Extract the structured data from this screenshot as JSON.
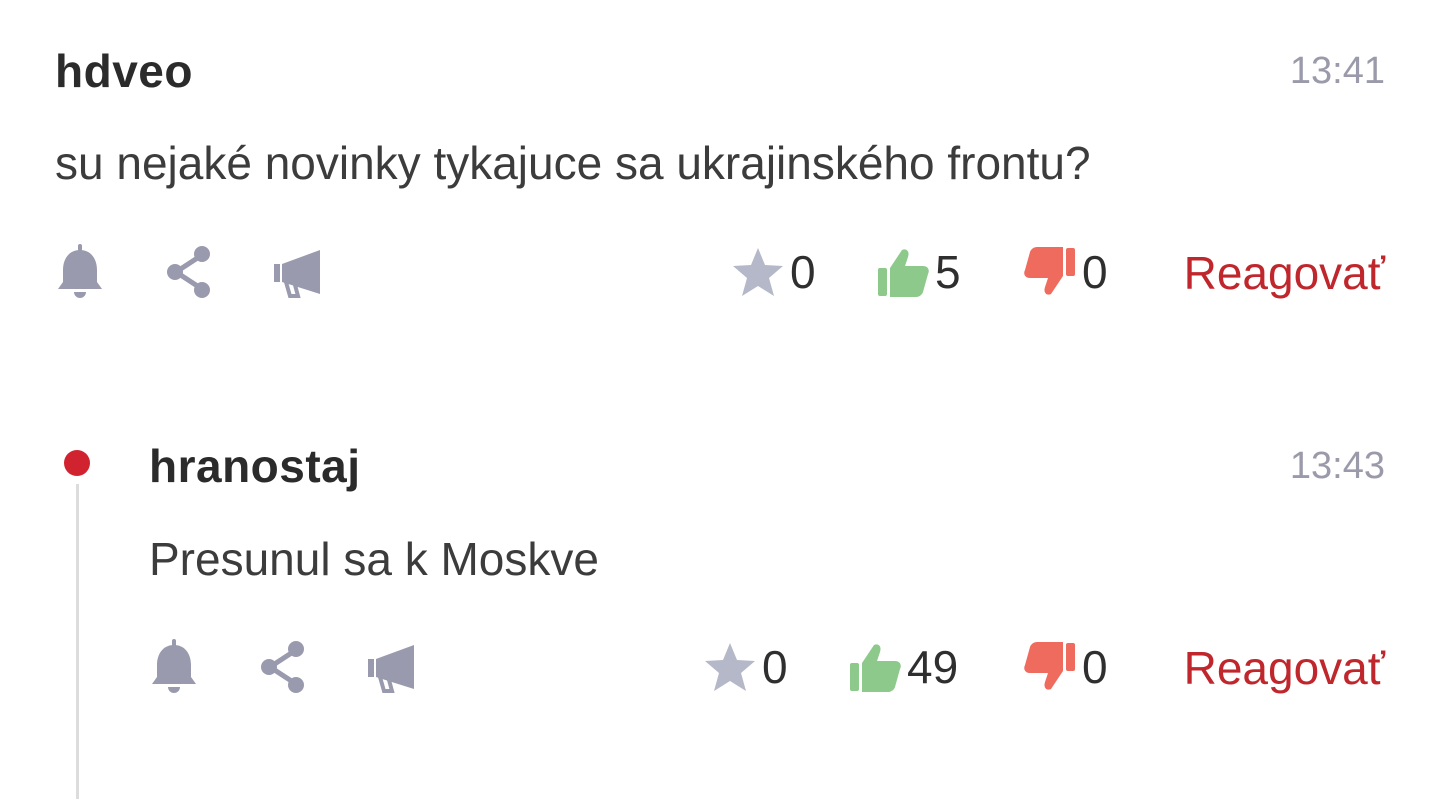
{
  "comments": [
    {
      "author": "hdveo",
      "time": "13:41",
      "text": "su nejaké novinky tykajuce sa ukrajinského frontu?",
      "stars": "0",
      "likes": "5",
      "dislikes": "0",
      "reply_label": "Reagovať"
    },
    {
      "author": "hranostaj",
      "time": "13:43",
      "text": "Presunul sa k Moskve",
      "stars": "0",
      "likes": "49",
      "dislikes": "0",
      "reply_label": "Reagovať"
    }
  ],
  "colors": {
    "reply": "#c0272d",
    "like": "#8cc98a",
    "dislike": "#ef6b5e",
    "icon": "#9a9aaf",
    "star": "#b4b8c8",
    "thread_dot": "#d0232f"
  },
  "icons": [
    "bell-icon",
    "share-icon",
    "megaphone-icon",
    "star-icon",
    "thumbs-up-icon",
    "thumbs-down-icon"
  ]
}
